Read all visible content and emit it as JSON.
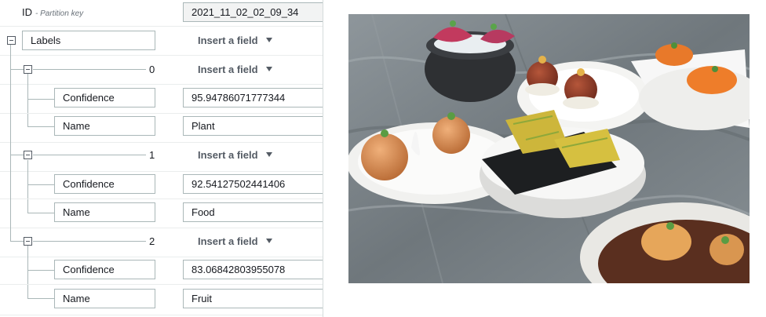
{
  "id_row": {
    "key": "ID",
    "key_note": "- Partition key",
    "value": "2021_11_02_02_09_34"
  },
  "labels_row": {
    "key": "Labels",
    "insert": "Insert a field"
  },
  "items": [
    {
      "index": "0",
      "insert": "Insert a field",
      "confidence_key": "Confidence",
      "confidence": "95.94786071777344",
      "name_key": "Name",
      "name": "Plant"
    },
    {
      "index": "1",
      "insert": "Insert a field",
      "confidence_key": "Confidence",
      "confidence": "92.54127502441406",
      "name_key": "Name",
      "name": "Food"
    },
    {
      "index": "2",
      "insert": "Insert a field",
      "confidence_key": "Confidence",
      "confidence": "83.06842803955078",
      "name_key": "Name",
      "name": "Fruit"
    }
  ],
  "icons": {
    "collapse": "minus-box-icon",
    "dropdown": "caret-down-icon"
  },
  "photo": {
    "subject": "plated-appetizers-on-marble-table"
  }
}
